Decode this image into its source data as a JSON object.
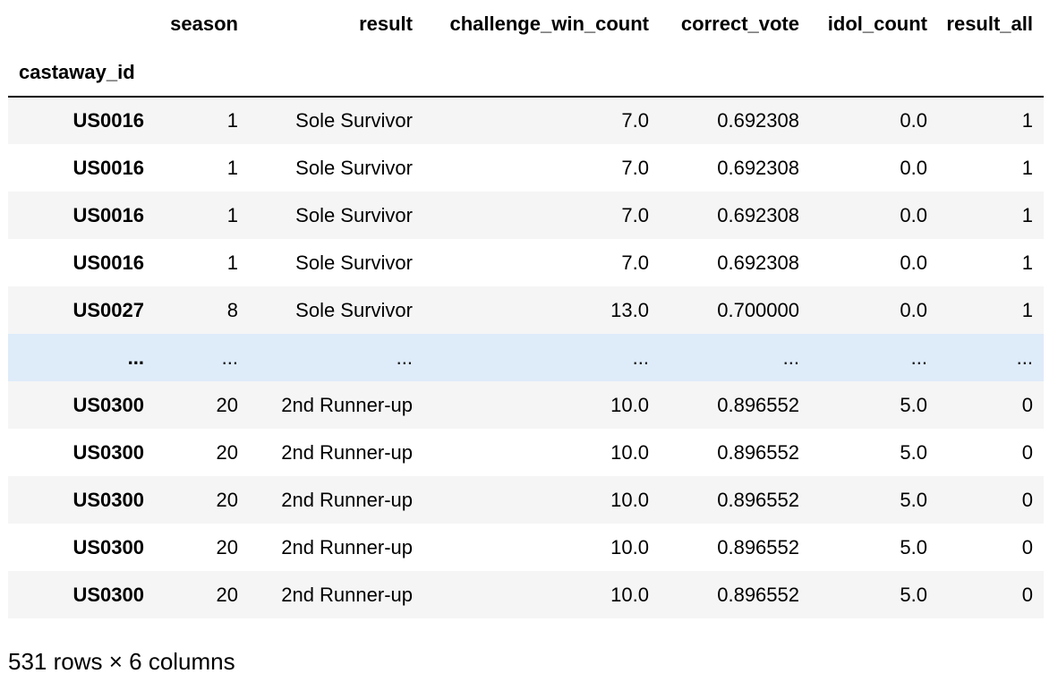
{
  "table": {
    "columns": [
      "season",
      "result",
      "challenge_win_count",
      "correct_vote",
      "idol_count",
      "result_all"
    ],
    "index_name": "castaway_id",
    "rows": [
      {
        "index": "US0016",
        "cells": [
          "1",
          "Sole Survivor",
          "7.0",
          "0.692308",
          "0.0",
          "1"
        ]
      },
      {
        "index": "US0016",
        "cells": [
          "1",
          "Sole Survivor",
          "7.0",
          "0.692308",
          "0.0",
          "1"
        ]
      },
      {
        "index": "US0016",
        "cells": [
          "1",
          "Sole Survivor",
          "7.0",
          "0.692308",
          "0.0",
          "1"
        ]
      },
      {
        "index": "US0016",
        "cells": [
          "1",
          "Sole Survivor",
          "7.0",
          "0.692308",
          "0.0",
          "1"
        ]
      },
      {
        "index": "US0027",
        "cells": [
          "8",
          "Sole Survivor",
          "13.0",
          "0.700000",
          "0.0",
          "1"
        ]
      },
      {
        "index": "...",
        "cells": [
          "...",
          "...",
          "...",
          "...",
          "...",
          "..."
        ]
      },
      {
        "index": "US0300",
        "cells": [
          "20",
          "2nd Runner-up",
          "10.0",
          "0.896552",
          "5.0",
          "0"
        ]
      },
      {
        "index": "US0300",
        "cells": [
          "20",
          "2nd Runner-up",
          "10.0",
          "0.896552",
          "5.0",
          "0"
        ]
      },
      {
        "index": "US0300",
        "cells": [
          "20",
          "2nd Runner-up",
          "10.0",
          "0.896552",
          "5.0",
          "0"
        ]
      },
      {
        "index": "US0300",
        "cells": [
          "20",
          "2nd Runner-up",
          "10.0",
          "0.896552",
          "5.0",
          "0"
        ]
      },
      {
        "index": "US0300",
        "cells": [
          "20",
          "2nd Runner-up",
          "10.0",
          "0.896552",
          "5.0",
          "0"
        ]
      }
    ],
    "ellipsis_row_color": "#deebf9",
    "stripe_color": "#f5f5f5"
  },
  "summary": "531 rows × 6 columns"
}
